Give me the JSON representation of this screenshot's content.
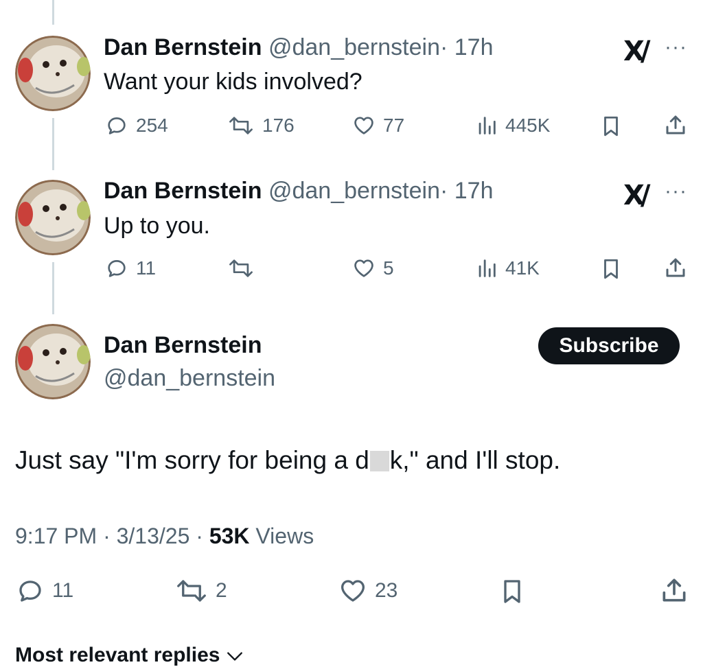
{
  "tweets": [
    {
      "name": "Dan Bernstein",
      "handle": "@dan_bernstein",
      "time": "· 17h",
      "text": "Want your kids involved?",
      "replies": "254",
      "reposts": "176",
      "likes": "77",
      "views": "445K"
    },
    {
      "name": "Dan Bernstein",
      "handle": "@dan_bernstein",
      "time": "· 17h",
      "text": "Up to you.",
      "replies": "11",
      "reposts": "",
      "likes": "5",
      "views": "41K"
    }
  ],
  "main": {
    "name": "Dan Bernstein",
    "handle": "@dan_bernstein",
    "subscribe_label": "Subscribe",
    "text_before": "Just say \"I'm sorry for being a d",
    "text_after": "k,\" and I'll stop.",
    "time": "9:17 PM · 3/13/25 · ",
    "views_count": "53K",
    "views_label": " Views",
    "replies": "11",
    "reposts": "2",
    "likes": "23"
  },
  "replies_header": "Most relevant replies",
  "icons": {
    "more": "more-icon",
    "xai": "xai-logo-icon",
    "reply": "reply-icon",
    "repost": "repost-icon",
    "like": "heart-icon",
    "views": "views-icon",
    "bookmark": "bookmark-icon",
    "share": "share-icon"
  },
  "colors": {
    "text": "#0f1419",
    "secondary": "#536471",
    "thread_line": "#cfd9de",
    "button_bg": "#0f1419"
  }
}
